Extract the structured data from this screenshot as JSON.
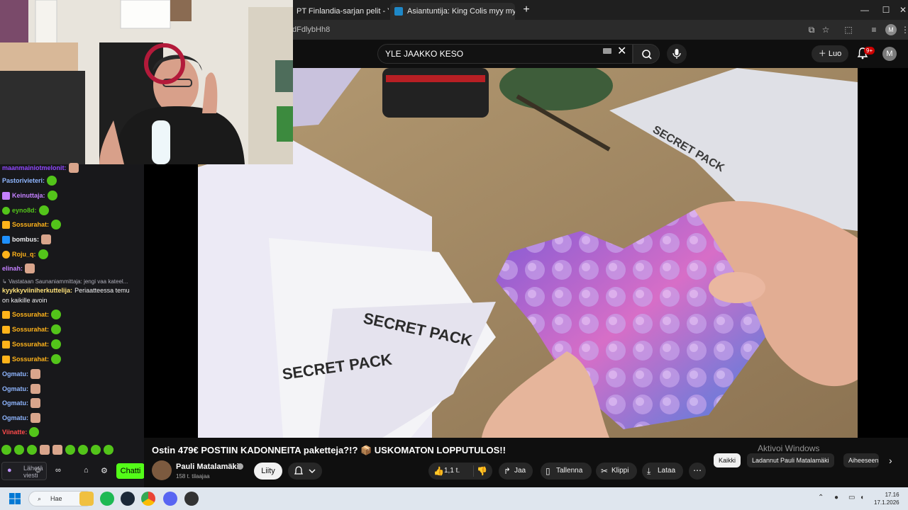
{
  "browser": {
    "tabs": [
      {
        "title": "PT Finlandia-sarjan pelit - You"
      },
      {
        "title": "Asiantuntija: King Colis myy my",
        "active": true
      }
    ],
    "url_fragment": "dFdlybHh8",
    "profile_initial": "M"
  },
  "youtube": {
    "search_query": "YLE JAAKKO KESO",
    "create_label": "Luo",
    "notifications_badge": "9+",
    "account_initial": "M",
    "video": {
      "title": "Ostin 479€ POSTIIN KADONNEITA paketteja?!? 📦 USKOMATON LOPPUTULOS!!",
      "channel": "Pauli Matalamäki",
      "subscribers": "158 t. tilaajaa",
      "join_label": "Liity",
      "likes": "1,1 t.",
      "share_label": "Jaa",
      "save_label": "Tallenna",
      "clip_label": "Klippi",
      "download_label": "Lataa",
      "overlay_text": "SECRET PACK"
    },
    "chips": [
      "Kaikki",
      "Ladannut Pauli Matalamäki",
      "Aiheeseen"
    ],
    "watermark": "Aktivoi Windows"
  },
  "chat": {
    "messages": [
      {
        "user": "maanmainiotmelonit:",
        "color": "#9147ff",
        "badge": "",
        "emote": "face"
      },
      {
        "user": "Pastorivieteri:",
        "color": "#8fb6ff",
        "badge": "",
        "emote": "green"
      },
      {
        "user": "Keinuttaja:",
        "color": "#c480ff",
        "badge": "#c480ff",
        "emote": "green"
      },
      {
        "user": "eyno8d:",
        "color": "#53c41a",
        "badge": "#53c41a",
        "emote": "green"
      },
      {
        "user": "Sossurahat:",
        "color": "#ffb31a",
        "badge": "#ffb31a",
        "emote": "green"
      },
      {
        "user": "bombus:",
        "color": "#efeff1",
        "badge": "#1e90ff",
        "emote": "face"
      },
      {
        "user": "Roju_q:",
        "color": "#ffb31a",
        "badge": "#ffb31a",
        "emote": "green"
      },
      {
        "user": "elinah:",
        "color": "#c480ff",
        "badge": "",
        "emote": "face"
      }
    ],
    "reply_to": "Vastataan Saunaniammittaja: jengi vaa kateel...",
    "reply_message": {
      "user": "kyykkyviiniherkuttelija:",
      "text": "Periaatteessa temu",
      "text2": "on kaikille avoin"
    },
    "messages2": [
      {
        "user": "Sossurahat:"
      },
      {
        "user": "Sossurahat:"
      },
      {
        "user": "Sossurahat:"
      },
      {
        "user": "Sossurahat:"
      }
    ],
    "messages3": [
      {
        "user": "Ogmatu:"
      },
      {
        "user": "Ogmatu:"
      },
      {
        "user": "Ogmatu:"
      },
      {
        "user": "Ogmatu:"
      }
    ],
    "last_user": "Viinatte:",
    "input_placeholder": "Lähetä viesti",
    "chat_button": "Chatti"
  },
  "taskbar": {
    "search_label": "Hae",
    "time": "17.16",
    "date": "17.1.2026"
  }
}
